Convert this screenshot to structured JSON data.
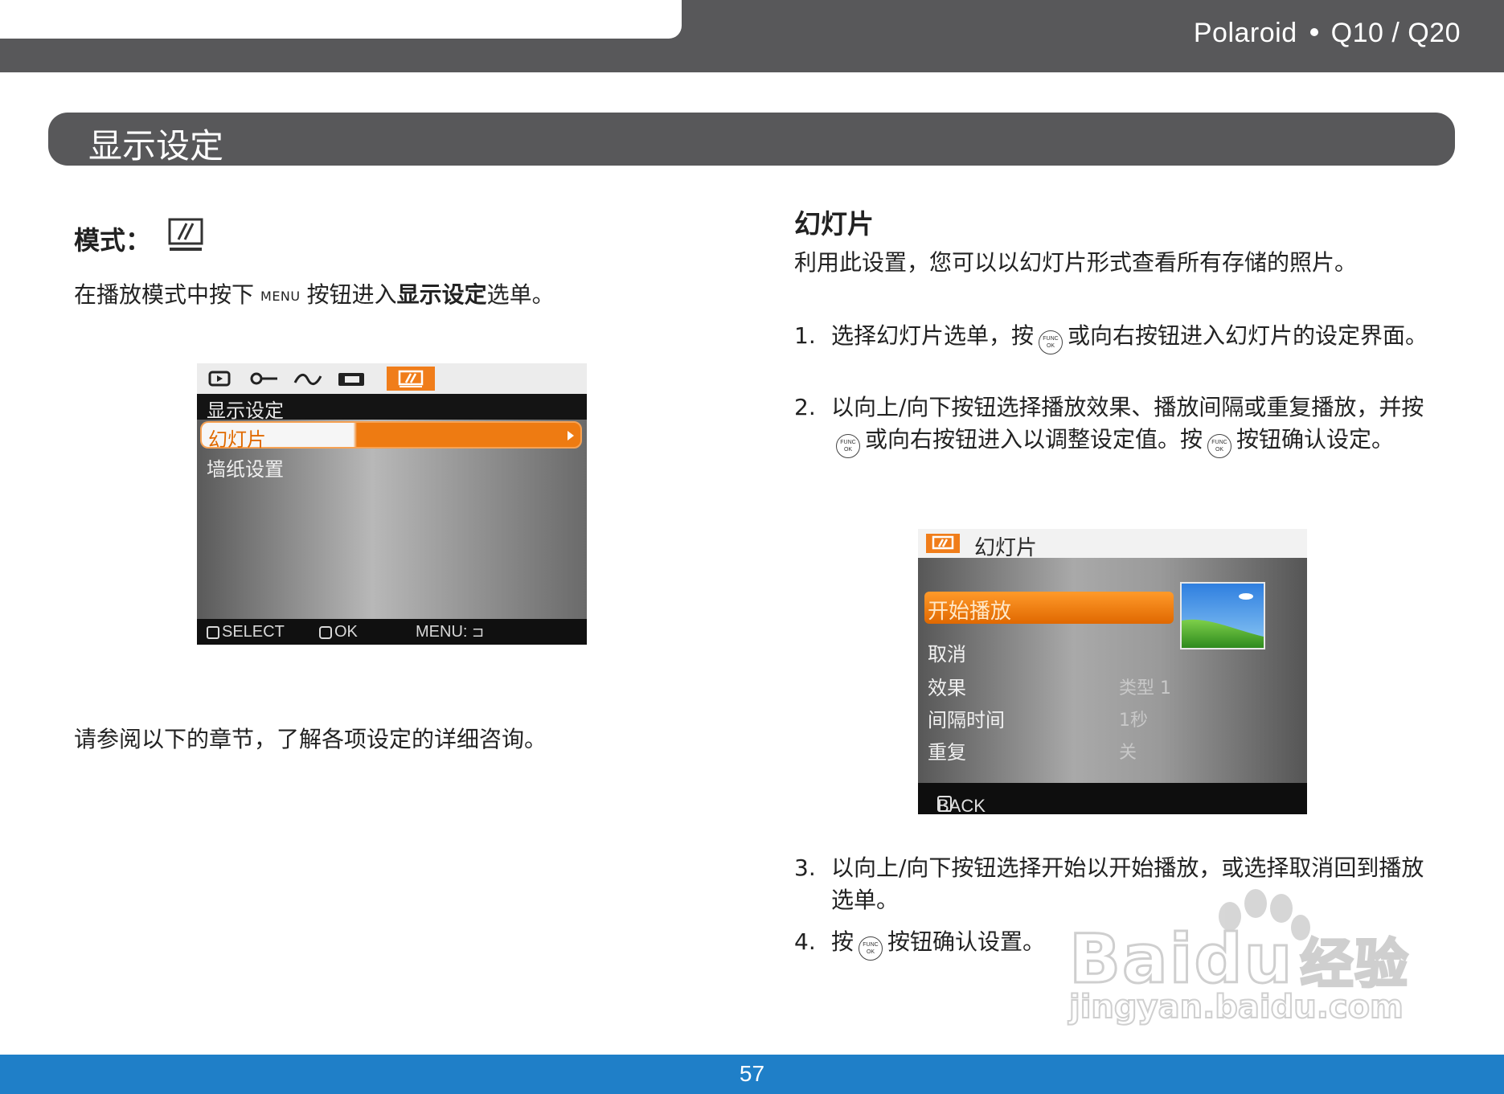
{
  "header": {
    "brand": "Polaroid",
    "model": "Q10 / Q20"
  },
  "section": {
    "title": "显示设定"
  },
  "left": {
    "mode_label": "模式：",
    "mode_icon": "display-setting-icon",
    "para1_pre": "在播放模式中按下",
    "menu_key": "MENU",
    "para1_mid": "按钮进入",
    "para1_bold": "显示设定",
    "para1_post": "选单。",
    "para2": "请参阅以下的章节，了解各项设定的详细咨询。"
  },
  "screen1": {
    "tabs": [
      "play-icon",
      "wrench-icon",
      "wave-icon",
      "printer-icon",
      "display-setting-icon"
    ],
    "title": "显示设定",
    "items": [
      "幻灯片",
      "墙纸设置"
    ],
    "footer": {
      "select": "SELECT",
      "ok": "OK",
      "menu": "MENU:"
    }
  },
  "right": {
    "heading": "幻灯片",
    "intro": "利用此设置，您可以以幻灯片形式查看所有存储的照片。",
    "steps": [
      {
        "num": "1.",
        "a": "选择幻灯片选单，按",
        "b": "或向右按钮进入幻灯片的设定界面。"
      },
      {
        "num": "2.",
        "a": "以向上/向下按钮选择播放效果、播放间隔或重复播放，并按",
        "b": "或向右按钮进入以调整设定值。按",
        "c": "按钮确认设定。"
      },
      {
        "num": "3.",
        "a": "以向上/向下按钮选择开始以开始播放，或选择取消回到播放选单。"
      },
      {
        "num": "4.",
        "a": "按",
        "b": "按钮确认设置。"
      }
    ],
    "func_button": {
      "line1": "FUNC",
      "line2": "OK"
    }
  },
  "screen2": {
    "title": "幻灯片",
    "selected": "开始播放",
    "cancel": "取消",
    "settings": [
      {
        "label": "效果",
        "value": "类型 1"
      },
      {
        "label": "间隔时间",
        "value": "1秒"
      },
      {
        "label": "重复",
        "value": "关"
      }
    ],
    "footer": "BACK"
  },
  "watermark": {
    "brand": "Baidu",
    "cn": "经验",
    "url": "jingyan.baidu.com"
  },
  "footer": {
    "page": "57"
  },
  "colors": {
    "header_gray": "#58585a",
    "accent_orange": "#f07d1a",
    "footer_blue": "#1f7fc8"
  }
}
